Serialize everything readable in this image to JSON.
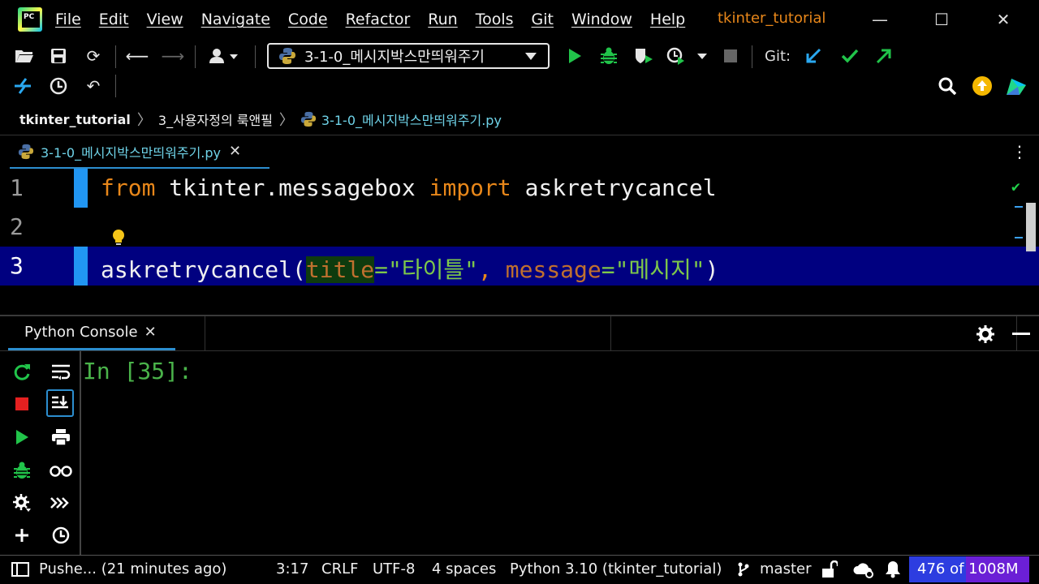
{
  "titlebar": {
    "menu": [
      "File",
      "Edit",
      "View",
      "Navigate",
      "Code",
      "Refactor",
      "Run",
      "Tools",
      "Git",
      "Window",
      "Help"
    ],
    "window_title": "tkinter_tutorial",
    "minimize": "—",
    "maximize": "☐",
    "close": "✕"
  },
  "toolbar": {
    "run_config": "3-1-0_메시지박스만띄워주기",
    "git_label": "Git:"
  },
  "breadcrumb": {
    "project": "tkinter_tutorial",
    "folder": "3_사용자정의 룩앤필",
    "file": "3-1-0_메시지박스만띄워주기.py"
  },
  "editor_tab": {
    "label": "3-1-0_메시지박스만띄워주기.py",
    "close": "✕",
    "menu": "⋮"
  },
  "editor": {
    "line_numbers": [
      "1",
      "2",
      "3"
    ],
    "line1": {
      "kw_from": "from",
      "module": " tkinter.messagebox ",
      "kw_import": "import",
      "name": " askretrycancel"
    },
    "line3": {
      "func": "askretrycancel(",
      "param1": "title",
      "eq1": "=",
      "str1": "\"타이틀\"",
      "comma": ", ",
      "param2": "message",
      "eq2": "=",
      "str2": "\"메시지\"",
      "close": ")"
    },
    "check": "✔"
  },
  "tool_window": {
    "tab_label": "Python Console",
    "tab_close": "✕"
  },
  "console": {
    "prompt": "In [35]:"
  },
  "statusbar": {
    "push_status": "Pushe... (21 minutes ago)",
    "position": "3:17",
    "line_sep": "CRLF",
    "encoding": "UTF-8",
    "indent": "4 spaces",
    "interpreter": "Python 3.10 (tkinter_tutorial)",
    "branch": "master",
    "memory": "476 of 1008M",
    "memory_used_fraction": 0.4722
  },
  "colors": {
    "accent": "#2c8ecf",
    "current_line": "#000080",
    "keyword": "#e8871a",
    "string": "#7ec84a",
    "prompt": "#4ab34a",
    "memory_bar": "#6b1fd6"
  }
}
